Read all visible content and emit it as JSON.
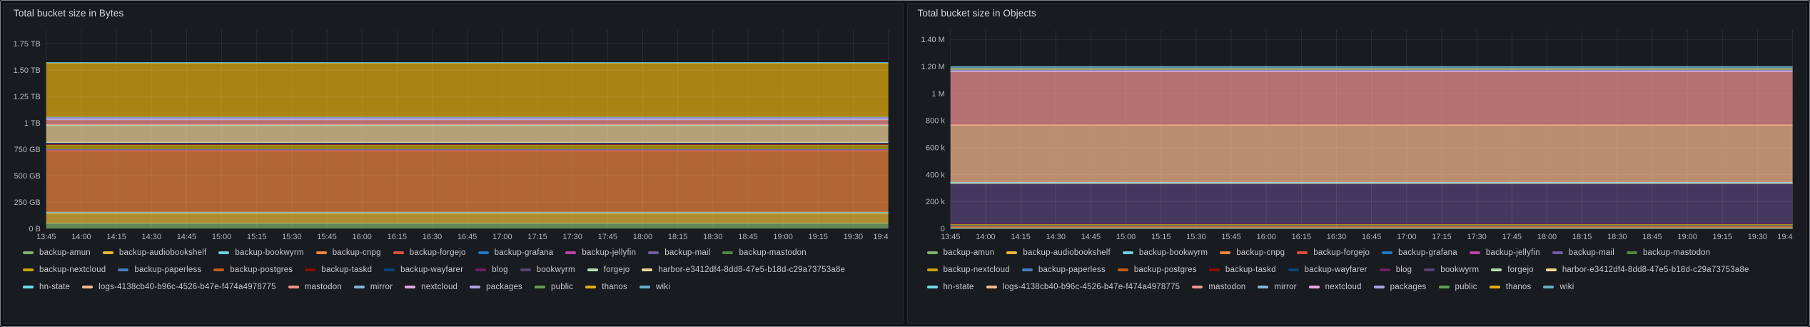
{
  "app": {
    "background_color": "#111217",
    "panel_background": "#181b1f",
    "title_color": "#d8d9da",
    "axis_text_color": "#b6b7be",
    "grid_color": "rgba(204,204,220,0.10)"
  },
  "chart_data": [
    {
      "type": "area",
      "stacked": true,
      "constant_over_time": true,
      "title": "Total bucket size in Bytes",
      "xlabel": "",
      "ylabel": "",
      "value_unit": "GB",
      "y_max_units": 1880,
      "grid": true,
      "legend_position": "bottom",
      "x_ticks": [
        "13:45",
        "14:00",
        "14:15",
        "14:30",
        "14:45",
        "15:00",
        "15:15",
        "15:30",
        "15:45",
        "16:00",
        "16:15",
        "16:30",
        "16:45",
        "17:00",
        "17:15",
        "17:30",
        "17:45",
        "18:00",
        "18:15",
        "18:30",
        "18:45",
        "19:00",
        "19:15",
        "19:30",
        "19:4"
      ],
      "y_ticks": [
        {
          "value": 0,
          "label": "0 B"
        },
        {
          "value": 250,
          "label": "250 GB"
        },
        {
          "value": 500,
          "label": "500 GB"
        },
        {
          "value": 750,
          "label": "750 GB"
        },
        {
          "value": 1000,
          "label": "1 TB"
        },
        {
          "value": 1250,
          "label": "1.25 TB"
        },
        {
          "value": 1500,
          "label": "1.50 TB"
        },
        {
          "value": 1750,
          "label": "1.75 TB"
        }
      ],
      "series": [
        {
          "name": "backup-amun",
          "color": "#7EB26D",
          "value": 50
        },
        {
          "name": "backup-audiobookshelf",
          "color": "#EAB839",
          "value": 95
        },
        {
          "name": "backup-bookwyrm",
          "color": "#6ED0E0",
          "value": 8
        },
        {
          "name": "backup-cnpg",
          "color": "#EF843C",
          "value": 585
        },
        {
          "name": "backup-forgejo",
          "color": "#E24D42",
          "value": 5
        },
        {
          "name": "backup-grafana",
          "color": "#1F78C1",
          "value": 2
        },
        {
          "name": "backup-jellyfin",
          "color": "#BA43A9",
          "value": 2
        },
        {
          "name": "backup-mail",
          "color": "#705DA0",
          "value": 3
        },
        {
          "name": "backup-mastodon",
          "color": "#508642",
          "value": 5
        },
        {
          "name": "backup-nextcloud",
          "color": "#CCA300",
          "value": 35
        },
        {
          "name": "backup-paperless",
          "color": "#447EBC",
          "value": 4
        },
        {
          "name": "backup-postgres",
          "color": "#C15C17",
          "value": 2
        },
        {
          "name": "backup-taskd",
          "color": "#890F02",
          "value": 1.5
        },
        {
          "name": "backup-wayfarer",
          "color": "#0A437C",
          "value": 12
        },
        {
          "name": "blog",
          "color": "#6D1F62",
          "value": 1.5
        },
        {
          "name": "bookwyrm",
          "color": "#584477",
          "value": 2
        },
        {
          "name": "forgejo",
          "color": "#B7DBAB",
          "value": 3
        },
        {
          "name": "harbor-e3412df4-8dd8-47e5-b18d-c29a73753a8e",
          "color": "#F4D598",
          "value": 160
        },
        {
          "name": "hn-state",
          "color": "#70DBED",
          "value": 2
        },
        {
          "name": "logs-4138cb40-b96c-4526-b47e-f474a4978775",
          "color": "#F9BA8F",
          "value": 4
        },
        {
          "name": "mastodon",
          "color": "#F29191",
          "value": 48
        },
        {
          "name": "mirror",
          "color": "#82B5D8",
          "value": 3
        },
        {
          "name": "nextcloud",
          "color": "#E5A8E2",
          "value": 5
        },
        {
          "name": "packages",
          "color": "#AEA2E0",
          "value": 18
        },
        {
          "name": "public",
          "color": "#629E51",
          "value": 4
        },
        {
          "name": "thanos",
          "color": "#E5AC0E",
          "value": 505
        },
        {
          "name": "wiki",
          "color": "#64B0C8",
          "value": 6
        }
      ]
    },
    {
      "type": "area",
      "stacked": true,
      "constant_over_time": true,
      "title": "Total bucket size in Objects",
      "xlabel": "",
      "ylabel": "",
      "value_unit": "thousand objects",
      "y_max_units": 1470,
      "grid": true,
      "legend_position": "bottom",
      "x_ticks": [
        "13:45",
        "14:00",
        "14:15",
        "14:30",
        "14:45",
        "15:00",
        "15:15",
        "15:30",
        "15:45",
        "16:00",
        "16:15",
        "16:30",
        "16:45",
        "17:00",
        "17:15",
        "17:30",
        "17:45",
        "18:00",
        "18:15",
        "18:30",
        "18:45",
        "19:00",
        "19:15",
        "19:30",
        "19:4"
      ],
      "y_ticks": [
        {
          "value": 0,
          "label": "0"
        },
        {
          "value": 200,
          "label": "200 k"
        },
        {
          "value": 400,
          "label": "400 k"
        },
        {
          "value": 600,
          "label": "600 k"
        },
        {
          "value": 800,
          "label": "800 k"
        },
        {
          "value": 1000,
          "label": "1 M"
        },
        {
          "value": 1200,
          "label": "1.20 M"
        },
        {
          "value": 1400,
          "label": "1.40 M"
        }
      ],
      "series": [
        {
          "name": "backup-amun",
          "color": "#7EB26D",
          "value": 2
        },
        {
          "name": "backup-audiobookshelf",
          "color": "#EAB839",
          "value": 2
        },
        {
          "name": "backup-bookwyrm",
          "color": "#6ED0E0",
          "value": 1
        },
        {
          "name": "backup-cnpg",
          "color": "#EF843C",
          "value": 18
        },
        {
          "name": "backup-forgejo",
          "color": "#E24D42",
          "value": 1
        },
        {
          "name": "backup-grafana",
          "color": "#1F78C1",
          "value": 0.5
        },
        {
          "name": "backup-jellyfin",
          "color": "#BA43A9",
          "value": 0.5
        },
        {
          "name": "backup-mail",
          "color": "#705DA0",
          "value": 0.5
        },
        {
          "name": "backup-mastodon",
          "color": "#508642",
          "value": 1
        },
        {
          "name": "backup-nextcloud",
          "color": "#CCA300",
          "value": 7
        },
        {
          "name": "backup-paperless",
          "color": "#447EBC",
          "value": 1
        },
        {
          "name": "backup-postgres",
          "color": "#C15C17",
          "value": 0.5
        },
        {
          "name": "backup-taskd",
          "color": "#890F02",
          "value": 0.5
        },
        {
          "name": "backup-wayfarer",
          "color": "#0A437C",
          "value": 1
        },
        {
          "name": "blog",
          "color": "#6D1F62",
          "value": 1
        },
        {
          "name": "bookwyrm",
          "color": "#584477",
          "value": 295
        },
        {
          "name": "forgejo",
          "color": "#B7DBAB",
          "value": 3
        },
        {
          "name": "harbor-e3412df4-8dd8-47e5-b18d-c29a73753a8e",
          "color": "#F4D598",
          "value": 2
        },
        {
          "name": "hn-state",
          "color": "#70DBED",
          "value": 4
        },
        {
          "name": "logs-4138cb40-b96c-4526-b47e-f474a4978775",
          "color": "#F9BA8F",
          "value": 425
        },
        {
          "name": "mastodon",
          "color": "#F29191",
          "value": 395
        },
        {
          "name": "mirror",
          "color": "#82B5D8",
          "value": 2
        },
        {
          "name": "nextcloud",
          "color": "#E5A8E2",
          "value": 2
        },
        {
          "name": "packages",
          "color": "#AEA2E0",
          "value": 12
        },
        {
          "name": "public",
          "color": "#629E51",
          "value": 2
        },
        {
          "name": "thanos",
          "color": "#E5AC0E",
          "value": 3
        },
        {
          "name": "wiki",
          "color": "#64B0C8",
          "value": 15
        }
      ]
    }
  ]
}
